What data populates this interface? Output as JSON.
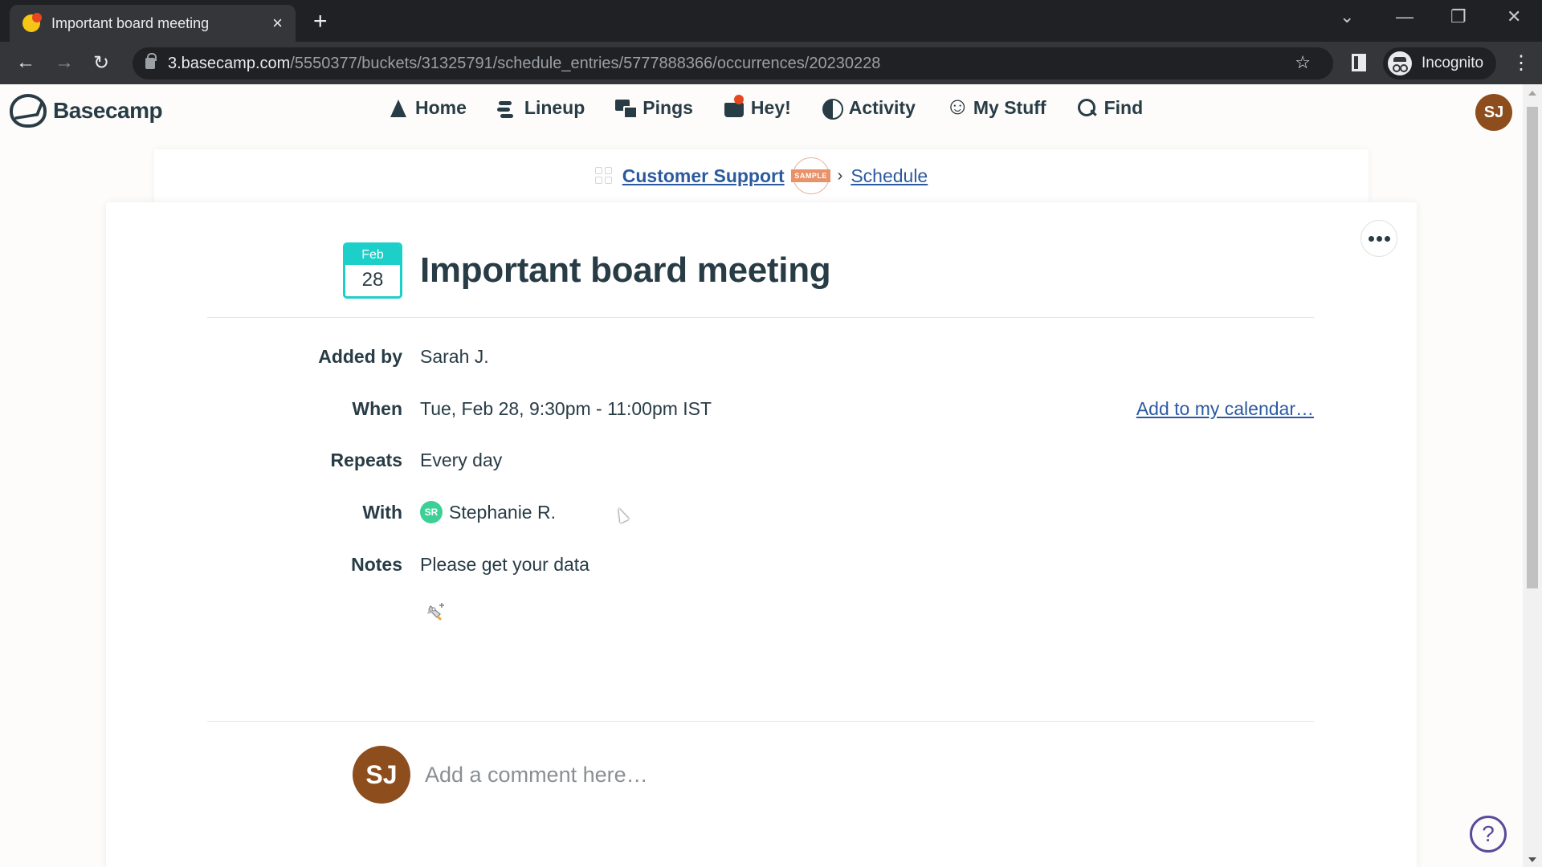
{
  "browser": {
    "tab": {
      "title": "Important board meeting",
      "favicon": "basecamp-favicon",
      "close_icon": "×"
    },
    "new_tab_icon": "+",
    "window_controls": {
      "tab_search": "⌄",
      "minimize": "—",
      "restore": "❐",
      "close": "✕"
    },
    "nav": {
      "back": "←",
      "forward": "→",
      "reload": "↻"
    },
    "url": {
      "host": "3.basecamp.com",
      "path": "/5550377/buckets/31325791/schedule_entries/5777888366/occurrences/20230228"
    },
    "bookmark_icon": "☆",
    "profile": {
      "label": "Incognito"
    },
    "menu_icon": "⋮"
  },
  "app_nav": {
    "logo_text": "Basecamp",
    "links": [
      {
        "label": "Home",
        "icon": "home-icon"
      },
      {
        "label": "Lineup",
        "icon": "lineup-icon"
      },
      {
        "label": "Pings",
        "icon": "pings-icon"
      },
      {
        "label": "Hey!",
        "icon": "hey-icon",
        "has_notification": true
      },
      {
        "label": "Activity",
        "icon": "activity-icon"
      },
      {
        "label": "My Stuff",
        "icon": "my-stuff-icon"
      },
      {
        "label": "Find",
        "icon": "find-icon"
      }
    ],
    "user_initials": "SJ"
  },
  "breadcrumb": {
    "project": "Customer Support",
    "badge": "SAMPLE",
    "separator": "›",
    "section": "Schedule"
  },
  "event": {
    "date": {
      "month": "Feb",
      "day": "28"
    },
    "title": "Important board meeting",
    "more_label": "•••",
    "details": [
      {
        "label": "Added by",
        "value": "Sarah J."
      },
      {
        "label": "When",
        "value": "Tue, Feb 28, 9:30pm - 11:00pm IST"
      },
      {
        "label": "Repeats",
        "value": "Every day"
      },
      {
        "label": "With",
        "value": "Stephanie R.",
        "avatar_initials": "SR"
      },
      {
        "label": "Notes",
        "value": "Please get your data"
      }
    ],
    "add_to_calendar": "Add to my calendar…"
  },
  "comment": {
    "avatar_initials": "SJ",
    "placeholder": "Add a comment here…"
  },
  "help_label": "?",
  "colors": {
    "brand_text": "#283c46",
    "link": "#2c5aa0",
    "calendar_accent": "#1ccfc9",
    "user_avatar": "#8d4d1c",
    "participant_avatar": "#3dcf95",
    "notification": "#e8461e",
    "sample_badge": "#e8926a"
  }
}
